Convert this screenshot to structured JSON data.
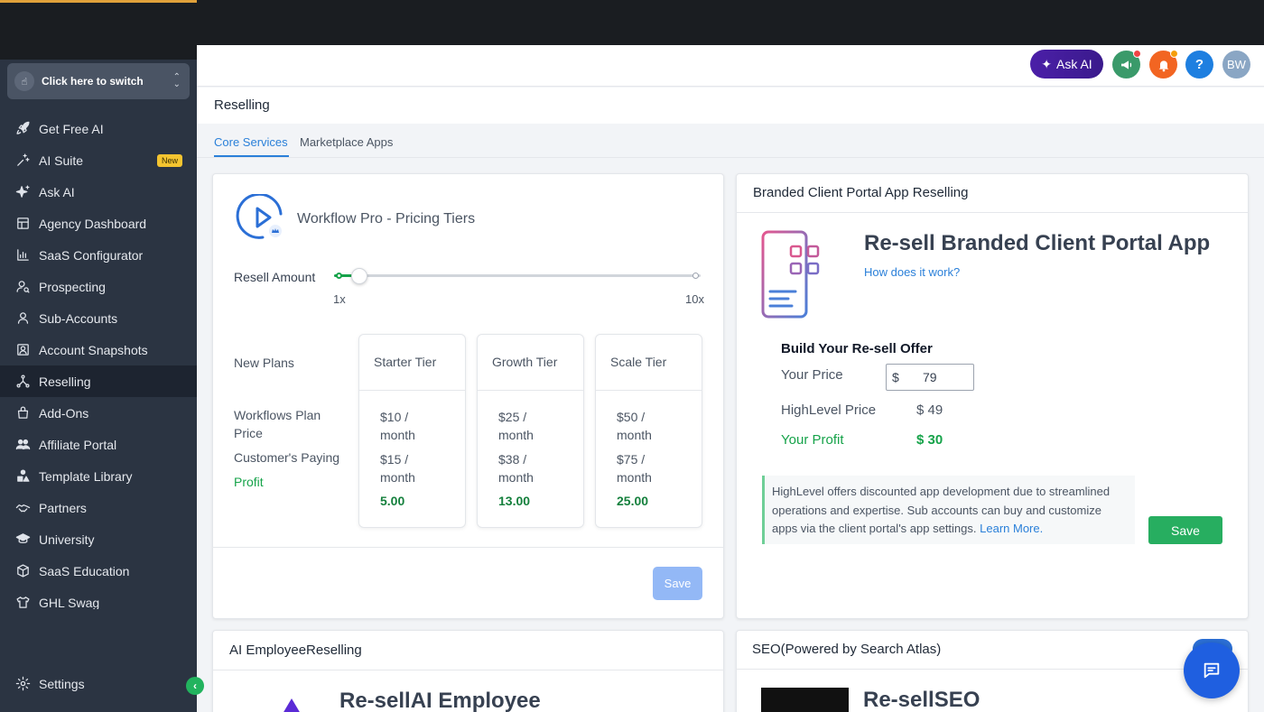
{
  "sidebar": {
    "switcher_label": "Click here to switch",
    "items": [
      {
        "label": "Get Free AI",
        "icon": "rocket-icon"
      },
      {
        "label": "AI Suite",
        "icon": "sparkle-icon",
        "badge": "New"
      },
      {
        "label": "Ask AI",
        "icon": "stars-icon"
      },
      {
        "label": "Agency Dashboard",
        "icon": "dashboard-icon"
      },
      {
        "label": "SaaS Configurator",
        "icon": "bar-chart-icon"
      },
      {
        "label": "Prospecting",
        "icon": "user-search-icon"
      },
      {
        "label": "Sub-Accounts",
        "icon": "user-icon"
      },
      {
        "label": "Account Snapshots",
        "icon": "snapshot-icon"
      },
      {
        "label": "Reselling",
        "icon": "reselling-icon",
        "active": true
      },
      {
        "label": "Add-Ons",
        "icon": "bag-icon"
      },
      {
        "label": "Affiliate Portal",
        "icon": "users-icon"
      },
      {
        "label": "Template Library",
        "icon": "shapes-icon"
      },
      {
        "label": "Partners",
        "icon": "handshake-icon"
      },
      {
        "label": "University",
        "icon": "graduation-cap-icon"
      },
      {
        "label": "SaaS Education",
        "icon": "box-icon"
      },
      {
        "label": "GHL Swag",
        "icon": "shirt-icon"
      }
    ],
    "settings_label": "Settings"
  },
  "header": {
    "ask_ai_label": "Ask AI",
    "avatar_initials": "BW",
    "help_label": "?"
  },
  "page": {
    "title": "Reselling",
    "tabs": [
      {
        "label": "Core Services",
        "active": true
      },
      {
        "label": "Marketplace Apps"
      }
    ]
  },
  "workflow_card": {
    "title": "Workflow Pro - Pricing Tiers",
    "resell_label": "Resell Amount",
    "slider_min_label": "1x",
    "slider_max_label": "10x",
    "slider_value_fraction": 0.05,
    "row_labels": {
      "new_plans": "New Plans",
      "plan_price": "Workflows Plan Price",
      "customer_paying": "Customer's Paying",
      "profit": "Profit"
    },
    "tiers": [
      {
        "name": "Starter Tier",
        "plan_price": "$10 / month",
        "customer_paying": "$15 / month",
        "profit": "5.00"
      },
      {
        "name": "Growth Tier",
        "plan_price": "$25 / month",
        "customer_paying": "$38 / month",
        "profit": "13.00"
      },
      {
        "name": "Scale Tier",
        "plan_price": "$50 / month",
        "customer_paying": "$75 / month",
        "profit": "25.00"
      }
    ],
    "save_label": "Save"
  },
  "branded_portal_card": {
    "header": "Branded Client Portal App Reselling",
    "title": "Re-sell Branded Client Portal App",
    "how_link": "How does it work?",
    "build_heading": "Build Your Re-sell Offer",
    "your_price_label": "Your Price",
    "currency_symbol": "$",
    "your_price_value": "79",
    "highlevel_price_label": "HighLevel Price",
    "highlevel_price_value": "$ 49",
    "your_profit_label": "Your Profit",
    "your_profit_value": "$ 30",
    "note_text": "HighLevel offers discounted app development due to streamlined operations and expertise. Sub accounts can buy and customize apps via the client portal's app settings.",
    "note_link": "Learn More.",
    "save_label": "Save"
  },
  "ai_employee_card": {
    "header": "AI EmployeeReselling",
    "title": "Re-sellAI Employee"
  },
  "seo_card": {
    "header": "SEO(Powered by Search Atlas)",
    "title": "Re-sellSEO"
  },
  "colors": {
    "sidebar_bg": "#2b3442",
    "accent_blue": "#2b80d9",
    "profit_green": "#16a34a",
    "save_green": "#27ae60",
    "ask_ai_purple": "#4b1fa8"
  }
}
